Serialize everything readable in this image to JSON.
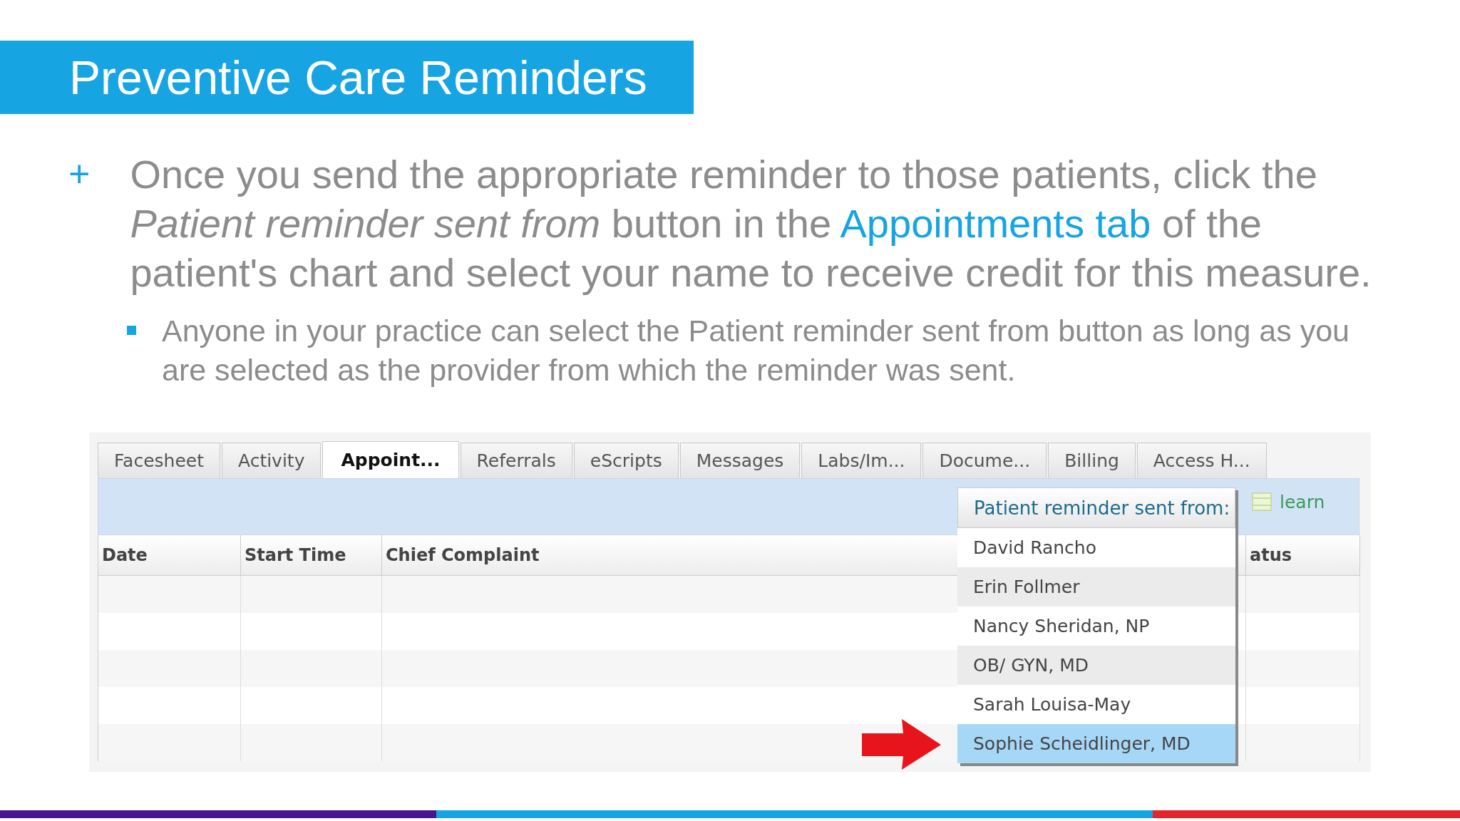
{
  "title": "Preventive Care Reminders",
  "bullet": {
    "marker": "+",
    "parts": [
      {
        "kind": "text",
        "text": "Once you send the appropriate reminder to those patients, click the "
      },
      {
        "kind": "italic",
        "text": "Patient reminder sent from"
      },
      {
        "kind": "text",
        "text": " button in the "
      },
      {
        "kind": "link",
        "text": "Appointments tab"
      },
      {
        "kind": "text",
        "text": " of the patient's chart and select your name to receive credit for this measure."
      }
    ]
  },
  "sub_bullet": "Anyone in your practice can select the Patient reminder sent from button as long as you are selected as the provider from which the reminder was sent.",
  "app": {
    "tabs": [
      {
        "label": "Facesheet",
        "selected": false
      },
      {
        "label": "Activity",
        "selected": false
      },
      {
        "label": "Appoint...",
        "selected": true
      },
      {
        "label": "Referrals",
        "selected": false
      },
      {
        "label": "eScripts",
        "selected": false
      },
      {
        "label": "Messages",
        "selected": false
      },
      {
        "label": "Labs/Im...",
        "selected": false
      },
      {
        "label": "Docume...",
        "selected": false
      },
      {
        "label": "Billing",
        "selected": false
      },
      {
        "label": "Access H...",
        "selected": false
      }
    ],
    "dropdown": {
      "label": "Patient reminder sent from:",
      "items": [
        {
          "label": "David Rancho",
          "selected": false
        },
        {
          "label": "Erin Follmer",
          "selected": false
        },
        {
          "label": "Nancy Sheridan, NP",
          "selected": false
        },
        {
          "label": "OB/ GYN, MD",
          "selected": false
        },
        {
          "label": "Sarah Louisa-May",
          "selected": false
        },
        {
          "label": "Sophie Scheidlinger, MD",
          "selected": true
        }
      ]
    },
    "learn_link": "learn",
    "columns": [
      "Date",
      "Start Time",
      "Chief Complaint",
      "atus"
    ]
  }
}
